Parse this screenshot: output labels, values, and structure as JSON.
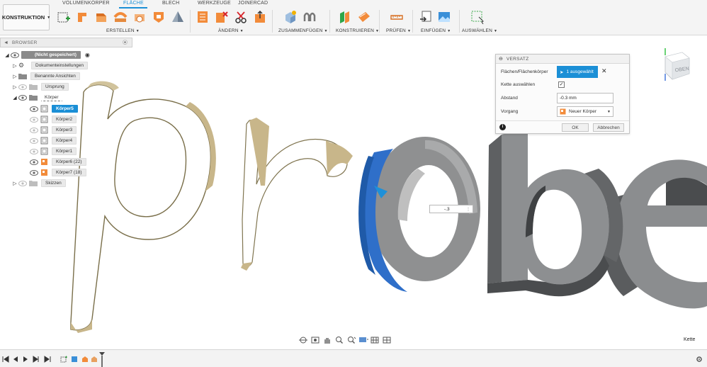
{
  "toolbar": {
    "workspace": "KONSTRUKTION",
    "tabs": [
      "VOLUMENKÖRPER",
      "FLÄCHE",
      "BLECH",
      "WERKZEUGE",
      "JOINERCAD"
    ],
    "groups": [
      "ERSTELLEN",
      "ÄNDERN",
      "ZUSAMMENFÜGEN",
      "KONSTRUIEREN",
      "PRÜFEN",
      "EINFÜGEN",
      "AUSWÄHLEN"
    ]
  },
  "browser": {
    "title": "BROWSER",
    "document": "(Nicht gespeichert)",
    "items": [
      {
        "label": "Dokumenteinstellungen"
      },
      {
        "label": "Benannte Ansichten"
      },
      {
        "label": "Ursprung"
      },
      {
        "label": "Körper"
      },
      {
        "label": "Körper5"
      },
      {
        "label": "Körper2"
      },
      {
        "label": "Körper3"
      },
      {
        "label": "Körper4"
      },
      {
        "label": "Körper1"
      },
      {
        "label": "Körper6 (22)"
      },
      {
        "label": "Körper7 (18)"
      },
      {
        "label": "Skizzen"
      }
    ]
  },
  "panel": {
    "title": "VERSATZ",
    "faces_label": "Flächen/Flächenkörper",
    "faces_value": "1 ausgewählt",
    "chain_label": "Kette auswählen",
    "distance_label": "Abstand",
    "distance_value": "-0.3 mm",
    "operation_label": "Vorgang",
    "operation_value": "Neuer Körper",
    "ok": "OK",
    "cancel": "Abbrechen"
  },
  "viewcube": {
    "label": "OBEN"
  },
  "canvas": {
    "dimension_value": "-.3"
  },
  "status": {
    "right_text": "Kette"
  },
  "colors": {
    "accent": "#1b8fd6",
    "surface_edge": "#8c7f55",
    "body_gray": "#8a8b8c"
  }
}
